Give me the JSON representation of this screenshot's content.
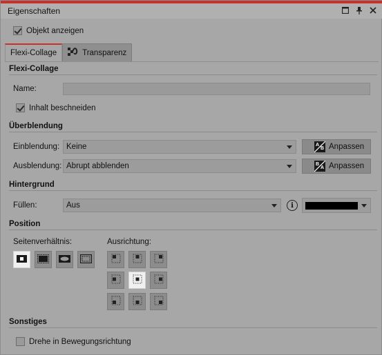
{
  "window": {
    "title": "Eigenschaften"
  },
  "show_object": {
    "label": "Objekt anzeigen",
    "checked": true
  },
  "tabs": [
    {
      "label": "Flexi-Collage",
      "active": true
    },
    {
      "label": "Transparenz",
      "active": false,
      "icon": "transparency-icon"
    }
  ],
  "flexi": {
    "heading": "Flexi-Collage",
    "name_label": "Name:",
    "name_value": "",
    "crop_label": "Inhalt beschneiden",
    "crop_checked": true
  },
  "blend": {
    "heading": "Überblendung",
    "in_label": "Einblendung:",
    "in_value": "Keine",
    "in_button": "Anpassen",
    "out_label": "Ausblendung:",
    "out_value": "Abrupt abblenden",
    "out_button": "Anpassen"
  },
  "background": {
    "heading": "Hintergrund",
    "fill_label": "Füllen:",
    "fill_value": "Aus",
    "info_glyph": "i",
    "color": "#000000"
  },
  "position": {
    "heading": "Position",
    "aspect_label": "Seitenverhältnis:",
    "alignment_label": "Ausrichtung:",
    "selected_alignment": "center"
  },
  "misc": {
    "heading": "Sonstiges",
    "rotate_label": "Drehe in Bewegungsrichtung",
    "rotate_checked": false
  },
  "colors": {
    "accent": "#c9302c",
    "panel": "#a7a7a7"
  }
}
